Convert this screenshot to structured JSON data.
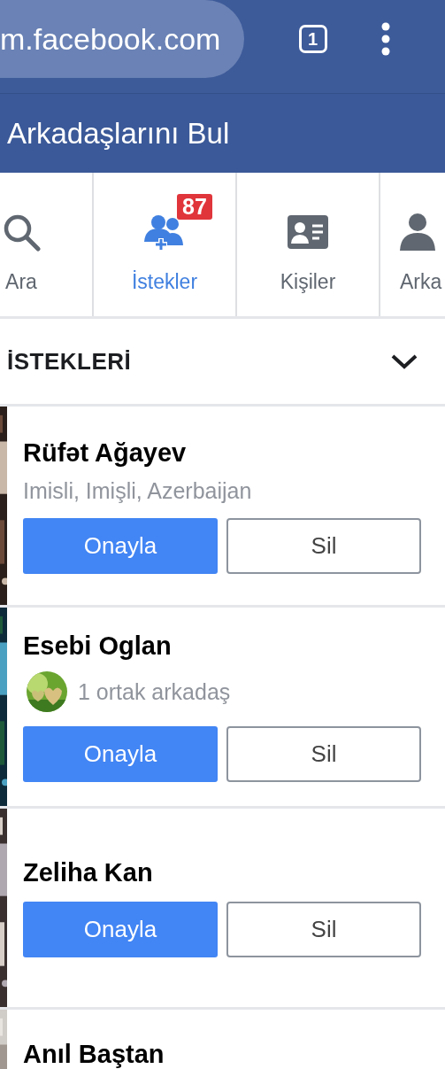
{
  "browser": {
    "url": "m.facebook.com",
    "tab_count": "1"
  },
  "header": {
    "title": "Arkadaşlarını Bul"
  },
  "tabs": [
    {
      "kind": "search",
      "label": "Ara",
      "selected": false
    },
    {
      "kind": "requests",
      "label": "İstekler",
      "selected": true,
      "badge": "87"
    },
    {
      "kind": "contacts",
      "label": "Kişiler",
      "selected": false
    },
    {
      "kind": "friends",
      "label": "Arka",
      "selected": false
    }
  ],
  "section": {
    "title": "İSTEKLERİ",
    "expanded": true
  },
  "requests": [
    {
      "name": "Rüfət Ağayev",
      "detail": {
        "kind": "location",
        "text": "Imisli, Imişli, Azerbaijan"
      },
      "confirm": "Onayla",
      "delete": "Sil"
    },
    {
      "name": "Esebi Oglan",
      "detail": {
        "kind": "mutual",
        "text": "1 ortak arkadaş"
      },
      "confirm": "Onayla",
      "delete": "Sil"
    },
    {
      "name": "Zeliha Kan",
      "confirm": "Onayla",
      "delete": "Sil"
    },
    {
      "name": "Anıl Baştan"
    }
  ]
}
